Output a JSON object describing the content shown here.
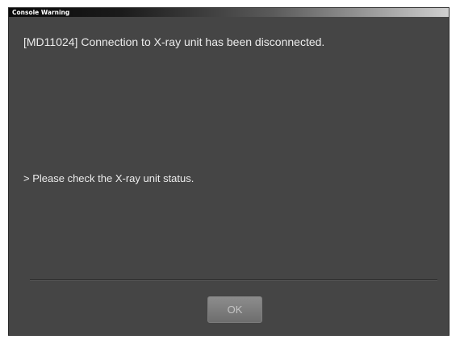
{
  "window": {
    "title": "Console Warning"
  },
  "message": {
    "text": "[MD11024] Connection to X-ray unit has been disconnected."
  },
  "hint": {
    "text": "> Please check the X-ray unit status."
  },
  "buttons": {
    "ok_label": "OK"
  },
  "colors": {
    "background": "#454545",
    "text": "#ececec",
    "button": "#7a7a7a"
  }
}
